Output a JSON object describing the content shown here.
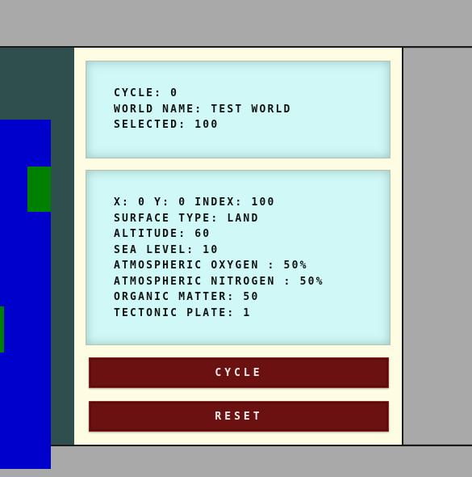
{
  "status": {
    "cycle": "CYCLE: 0",
    "world_name": "WORLD NAME: TEST WORLD",
    "selected": "SELECTED: 100"
  },
  "tile_info": {
    "coords": "X: 0 Y: 0 INDEX: 100",
    "surface_type": "SURFACE TYPE: LAND",
    "altitude": "ALTITUDE: 60",
    "sea_level": "SEA LEVEL: 10",
    "oxygen": "ATMOSPHERIC OXYGEN : 50%",
    "nitrogen": "ATMOSPHERIC NITROGEN : 50%",
    "organic_matter": "ORGANIC MATTER: 50",
    "tectonic_plate": "TECTONIC PLATE: 1"
  },
  "buttons": {
    "cycle": "CYCLE",
    "reset": "RESET"
  },
  "colors": {
    "water": "#0000cc",
    "land": "#008000",
    "button": "#6b1111",
    "info_background": "#cff8f6",
    "panel_background": "#fefde4"
  }
}
